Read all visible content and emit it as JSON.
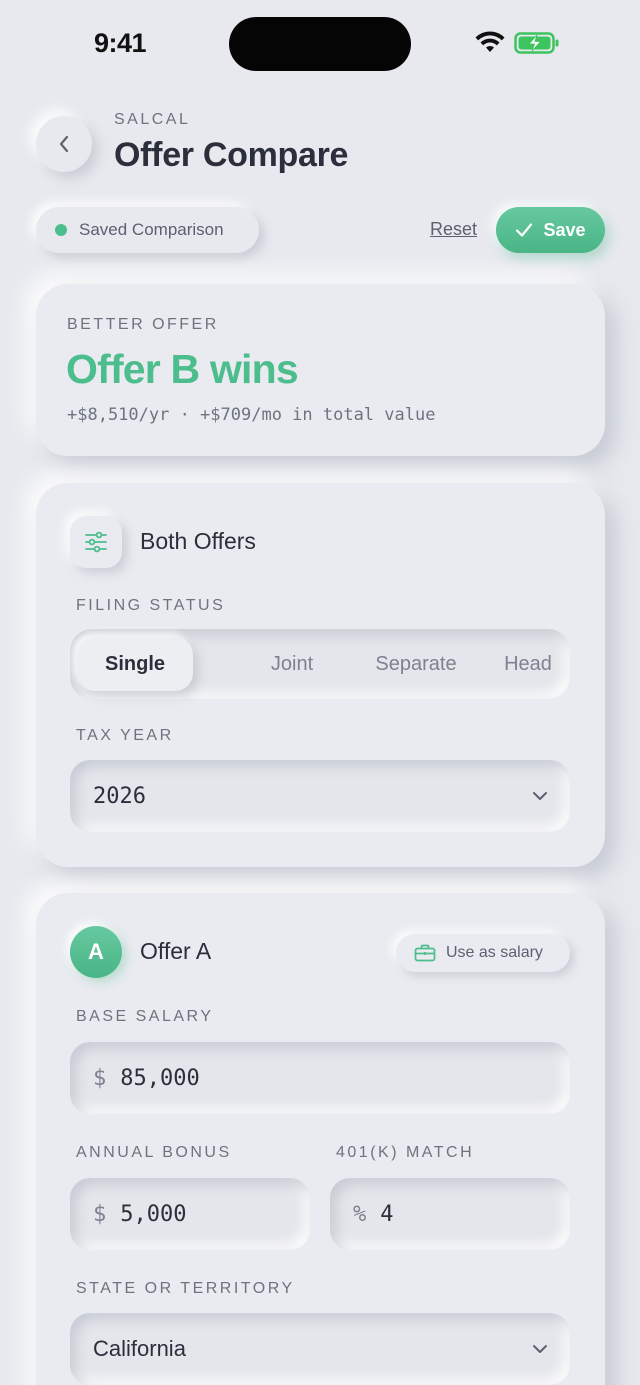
{
  "status_bar": {
    "time": "9:41"
  },
  "header": {
    "eyebrow": "SALCAL",
    "title": "Offer Compare"
  },
  "actions": {
    "saved_label": "Saved Comparison",
    "reset_label": "Reset",
    "save_label": "Save"
  },
  "result": {
    "eyebrow": "BETTER OFFER",
    "title": "Offer B wins",
    "subtitle": "+$8,510/yr · +$709/mo in total value"
  },
  "both_offers": {
    "title": "Both Offers",
    "filing_status_label": "FILING STATUS",
    "filing_options": [
      "Single",
      "Joint",
      "Separate",
      "Head"
    ],
    "filing_selected": "Single",
    "tax_year_label": "TAX YEAR",
    "tax_year": "2026"
  },
  "offer_a": {
    "avatar_letter": "A",
    "title": "Offer A",
    "use_salary_label": "Use as salary",
    "base_salary_label": "BASE SALARY",
    "base_salary_prefix": "$",
    "base_salary": "85,000",
    "bonus_label": "ANNUAL BONUS",
    "bonus_prefix": "$",
    "bonus": "5,000",
    "match_label": "401(K) MATCH",
    "match_prefix": "%",
    "match": "4",
    "state_label": "STATE OR TERRITORY",
    "state": "California"
  },
  "colors": {
    "accent": "#4cbd8c",
    "background": "#e7e9ee",
    "text": "#2a2f3b",
    "muted": "#6d7380"
  }
}
